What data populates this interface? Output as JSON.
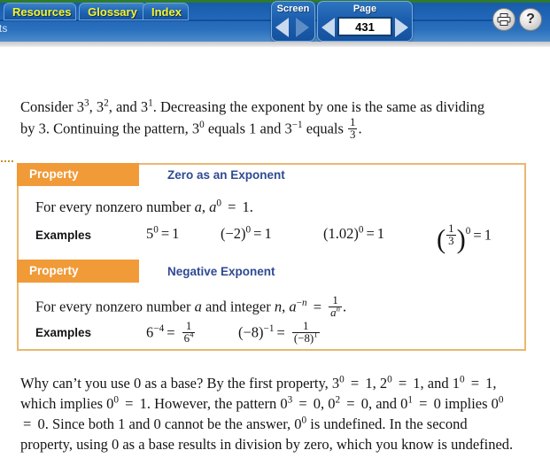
{
  "nav": {
    "tabs": [
      {
        "label": "Resources",
        "name": "resources"
      },
      {
        "label": "Glossary",
        "name": "glossary"
      },
      {
        "label": "Index",
        "name": "index"
      }
    ],
    "partial_label": "nts",
    "screen": {
      "label": "Screen",
      "prev_icon": "triangle-left-icon",
      "next_icon": "triangle-right-icon"
    },
    "page": {
      "label": "Page",
      "value": "431",
      "prev_icon": "triangle-left-icon",
      "next_icon": "triangle-right-icon"
    },
    "print": {
      "icon": "printer-icon",
      "tooltip": ""
    },
    "help": {
      "icon": "question-mark-icon",
      "glyph": "?"
    },
    "colors": {
      "bar_blue": "#1f63b4",
      "tab_yellow": "#f7f32a",
      "green_strip": "#2e7a2e"
    }
  },
  "lesson": {
    "intro": {
      "line1_pre": "Consider ",
      "line1_terms": "3³, 3², and 3¹",
      "line1_post": ". Decreasing the exponent by one is the same as dividing by 3. Continuing the pattern, 3⁰ equals 1 and 3⁻¹ equals 1/3."
    },
    "property_box": {
      "border_color": "#e8b870",
      "header_color": "#f09a38",
      "title_color": "#2f4a93",
      "properties": [
        {
          "header": "Property",
          "title": "Zero as an Exponent",
          "statement": "For every nonzero number a, a⁰ = 1.",
          "examples_label": "Examples",
          "examples": [
            "5⁰ = 1",
            "(−2)⁰ = 1",
            "(1.02)⁰ = 1",
            "(1/3)⁰ = 1"
          ]
        },
        {
          "header": "Property",
          "title": "Negative Exponent",
          "statement": "For every nonzero number a and integer n, a⁻ⁿ = 1/aⁿ.",
          "examples_label": "Examples",
          "examples": [
            "6⁻⁴ = 1/6⁴",
            "(−8)⁻¹ = 1/(−8)¹"
          ]
        }
      ]
    },
    "closing": "Why can't you use 0 as a base? By the first property, 3⁰ = 1, 2⁰ = 1, and 1⁰ = 1, which implies 0⁰ = 1. However, the pattern 0³ = 0, 0² = 0, and 0¹ = 0 implies 0⁰ = 0. Since both 1 and 0 cannot be the answer, 0⁰ is undefined. In the second property, using 0 as a base results in division by zero, which you know is undefined."
  }
}
